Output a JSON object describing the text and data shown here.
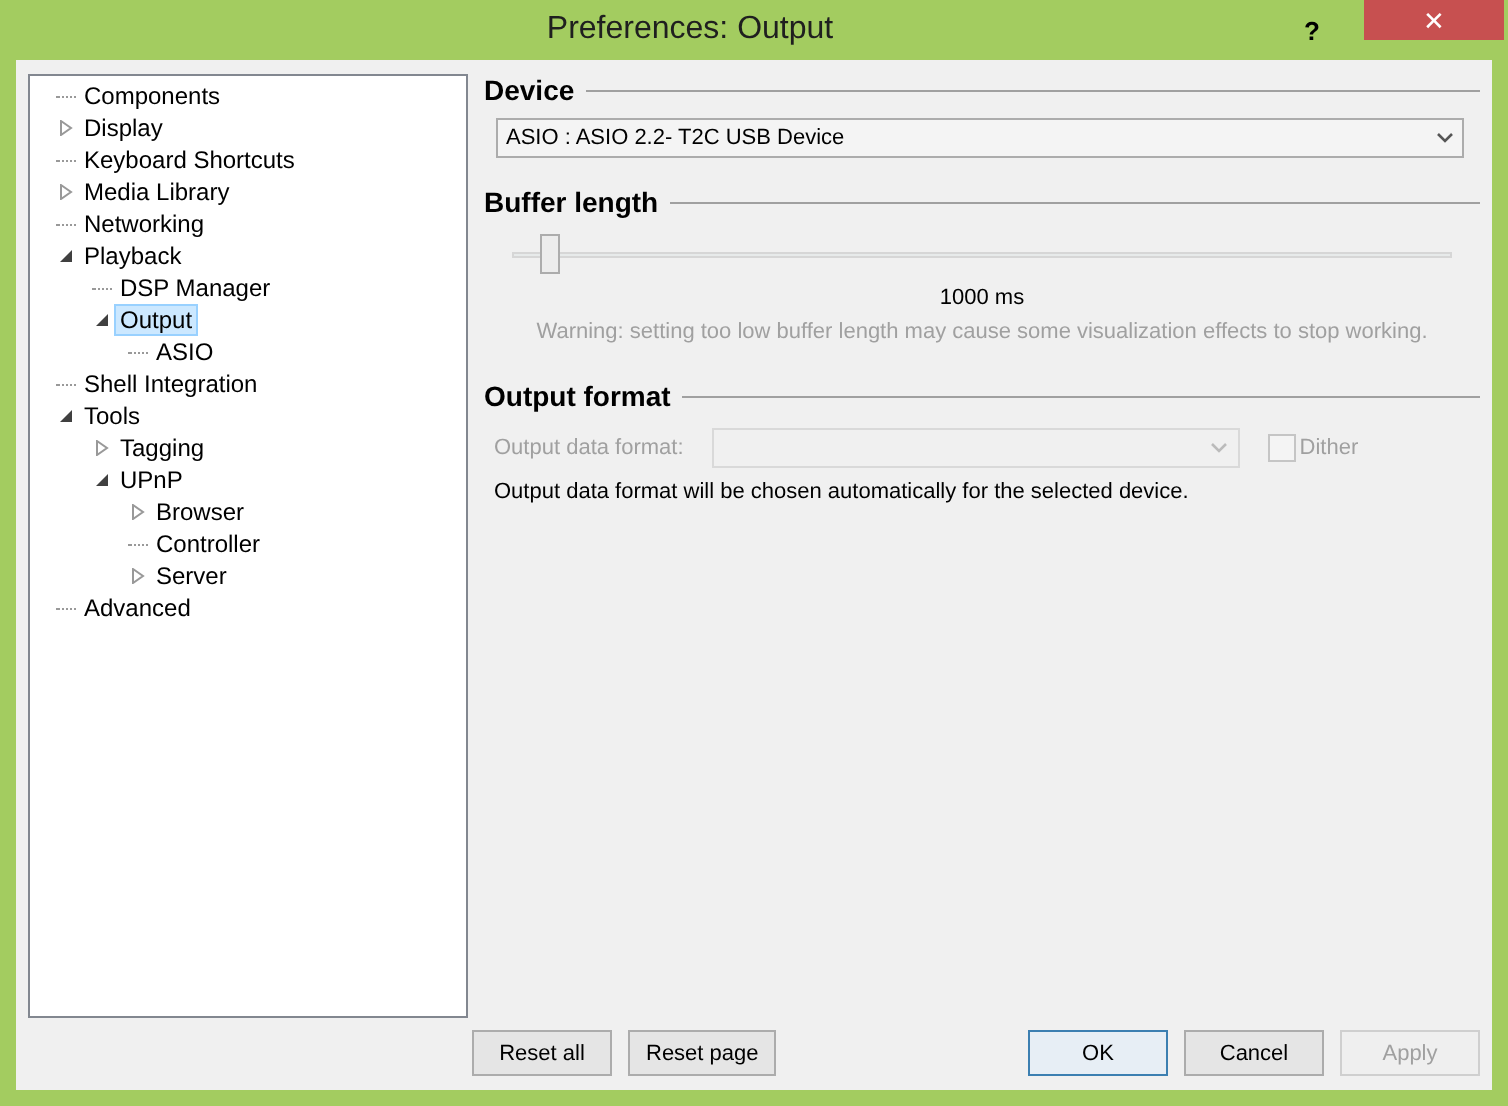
{
  "window": {
    "title": "Preferences: Output",
    "help": "?",
    "close": "✕"
  },
  "tree": [
    {
      "label": "Components",
      "selected": false
    },
    {
      "label": "Display",
      "selected": false,
      "expanded": false
    },
    {
      "label": "Keyboard Shortcuts",
      "selected": false
    },
    {
      "label": "Media Library",
      "selected": false,
      "expanded": false
    },
    {
      "label": "Networking",
      "selected": false
    },
    {
      "label": "Playback",
      "selected": false,
      "expanded": true,
      "children": [
        {
          "label": "DSP Manager",
          "selected": false
        },
        {
          "label": "Output",
          "selected": true,
          "expanded": true,
          "children": [
            {
              "label": "ASIO",
              "selected": false
            }
          ]
        }
      ]
    },
    {
      "label": "Shell Integration",
      "selected": false
    },
    {
      "label": "Tools",
      "selected": false,
      "expanded": true,
      "children": [
        {
          "label": "Tagging",
          "selected": false,
          "expanded": false
        },
        {
          "label": "UPnP",
          "selected": false,
          "expanded": true,
          "children": [
            {
              "label": "Browser",
              "selected": false,
              "expanded": false
            },
            {
              "label": "Controller",
              "selected": false
            },
            {
              "label": "Server",
              "selected": false,
              "expanded": false
            }
          ]
        }
      ]
    },
    {
      "label": "Advanced",
      "selected": false
    }
  ],
  "device": {
    "heading": "Device",
    "value": "ASIO : ASIO 2.2- T2C USB Device"
  },
  "buffer": {
    "heading": "Buffer length",
    "level": 0.04,
    "reading": "1000 ms",
    "warning": "Warning: setting too low buffer length may cause some visualization effects to stop working."
  },
  "output_format": {
    "heading": "Output format",
    "label": "Output data format:",
    "disabled": true,
    "dither": {
      "label": "Dither",
      "checked": false,
      "disabled": true
    },
    "note": "Output data format will be chosen automatically for the selected device."
  },
  "buttons": [
    {
      "label": "Reset all",
      "disabled": false,
      "default": false
    },
    {
      "label": "Reset page",
      "disabled": false,
      "default": false
    },
    {
      "label": "OK",
      "disabled": false,
      "default": true
    },
    {
      "label": "Cancel",
      "disabled": false,
      "default": false
    },
    {
      "label": "Apply",
      "disabled": true,
      "default": false
    }
  ]
}
